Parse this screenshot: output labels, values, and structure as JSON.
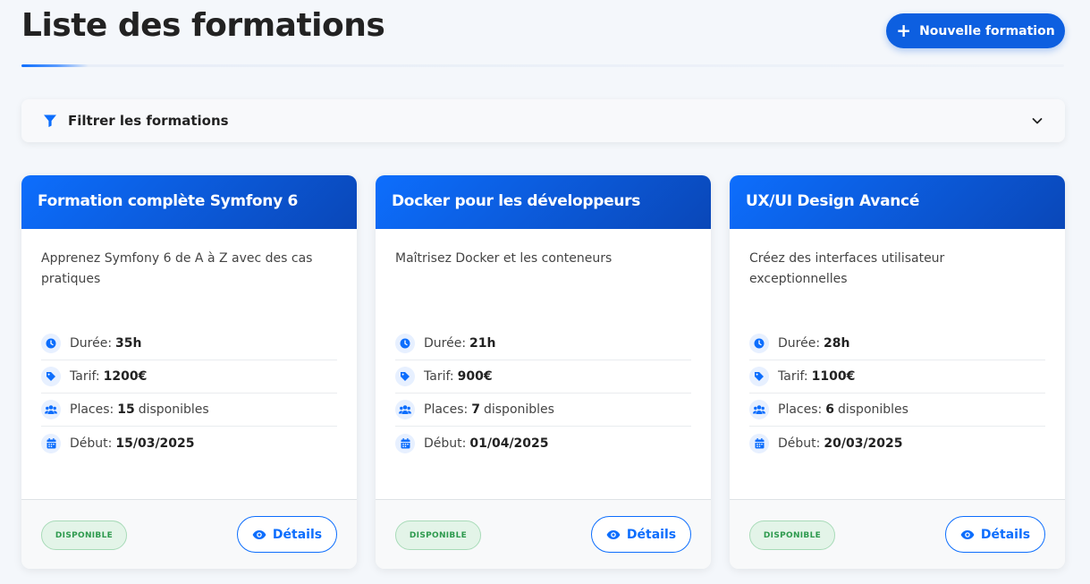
{
  "page": {
    "title": "Liste des formations",
    "new_button_label": "Nouvelle formation"
  },
  "filter": {
    "title": "Filtrer les formations"
  },
  "labels": {
    "duration": "Durée:",
    "price": "Tarif:",
    "places": "Places:",
    "places_suffix": "disponibles",
    "start": "Début:",
    "details_button": "Détails"
  },
  "colors": {
    "primary": "#0d6efd",
    "header_gradient_end": "#0a47b8",
    "badge_text": "#2e9a4e",
    "badge_bg": "#e3f4e8"
  },
  "icons": {
    "new_button": "plus-icon",
    "filter": "funnel-icon",
    "filter_toggle": "chevron-down-icon",
    "duration": "clock-icon",
    "price": "tag-icon",
    "places": "users-icon",
    "start": "calendar-icon",
    "details": "eye-icon"
  },
  "formations": [
    {
      "title": "Formation complète Symfony 6",
      "description": "Apprenez Symfony 6 de A à Z avec des cas pratiques",
      "duration": "35h",
      "price": "1200€",
      "places": "15",
      "start": "15/03/2025",
      "status": "DISPONIBLE"
    },
    {
      "title": "Docker pour les développeurs",
      "description": "Maîtrisez Docker et les conteneurs",
      "duration": "21h",
      "price": "900€",
      "places": "7",
      "start": "01/04/2025",
      "status": "DISPONIBLE"
    },
    {
      "title": "UX/UI Design Avancé",
      "description": "Créez des interfaces utilisateur exceptionnelles",
      "duration": "28h",
      "price": "1100€",
      "places": "6",
      "start": "20/03/2025",
      "status": "DISPONIBLE"
    }
  ]
}
